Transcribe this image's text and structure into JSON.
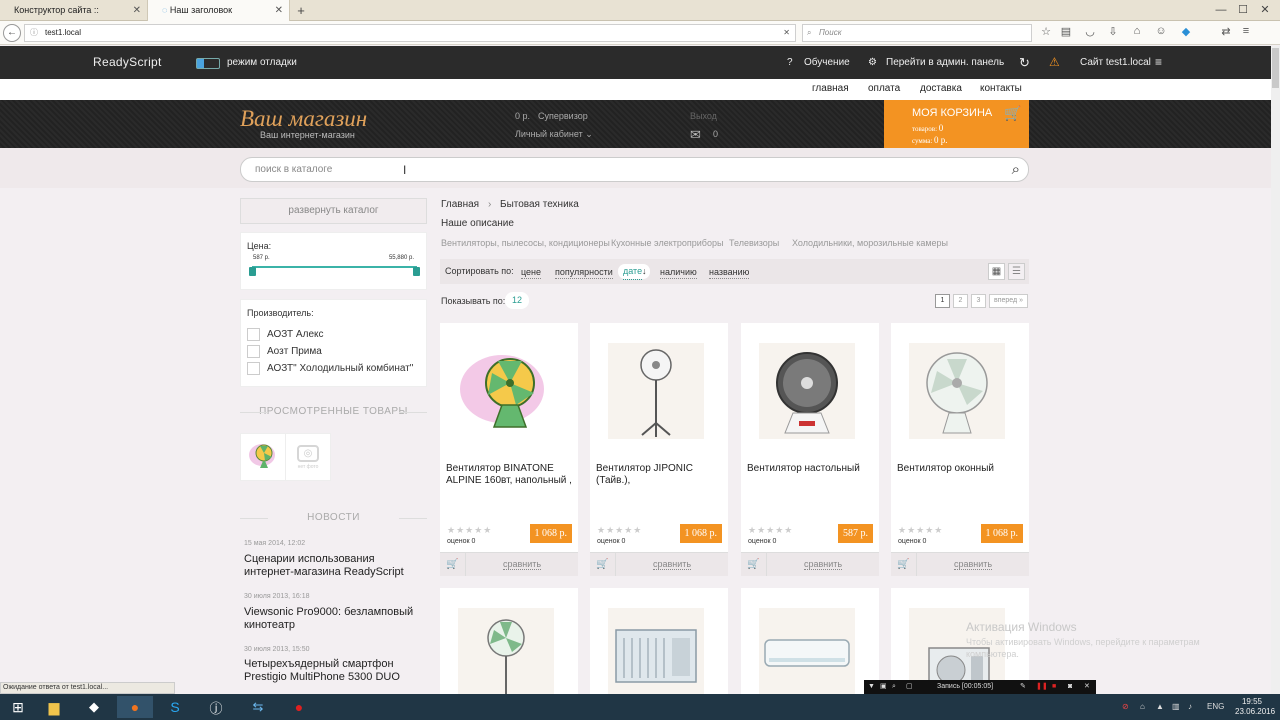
{
  "browser": {
    "tabs": [
      {
        "label": "Конструктор сайта :: Админи..."
      },
      {
        "label": "Наш заголовок"
      }
    ],
    "new_tab": "+",
    "url": "test1.local",
    "search_placeholder": "Поиск",
    "status_text": "Ожидание ответа от test1.local..."
  },
  "admin_bar": {
    "brand": "ReadyScript",
    "debug_label": "режим отладки",
    "tutorial": "Обучение",
    "go_admin": "Перейти в админ. панель",
    "site": "Сайт test1.local"
  },
  "top_menu": [
    "главная",
    "оплата",
    "доставка",
    "контакты"
  ],
  "header": {
    "logo": "Ваш магазин",
    "tagline": "Ваш интернет-магазин",
    "balance": "0 р.",
    "user": "Супервизор",
    "cabinet": "Личный кабинет",
    "logout": "Выход",
    "messages": "0",
    "cart": {
      "title": "МОЯ КОРЗИНА",
      "items_label": "товаров:",
      "items": "0",
      "sum_label": "сумма:",
      "sum": "0 р."
    }
  },
  "search": {
    "placeholder": "поиск в каталоге"
  },
  "sidebar": {
    "expand_catalog": "развернуть каталог",
    "price": {
      "label": "Цена:",
      "min": "587 р.",
      "max": "55,880 р."
    },
    "maker_label": "Производитель:",
    "makers": [
      "АОЗТ Алекс",
      "Аозт Прима",
      "АОЗТ\" Холодильный комбинат\""
    ],
    "viewed_title": "ПРОСМОТРЕННЫЕ ТОВАРЫ",
    "viewed_noimg": "нет фото",
    "news_title": "НОВОСТИ",
    "news": [
      {
        "date": "15 мая 2014, 12:02",
        "title": "Сценарии использования интернет-магазина ReadyScript"
      },
      {
        "date": "30 июля 2013, 16:18",
        "title": "Viewsonic Pro9000: безламповый кинотеатр"
      },
      {
        "date": "30 июля 2013, 15:50",
        "title": "Четырехъядерный смартфон Prestigio MultiPhone 5300 DUO"
      }
    ]
  },
  "main": {
    "breadcrumb": [
      "Главная",
      "Бытовая техника"
    ],
    "description": "Наше описание",
    "subcategories": [
      "Вентиляторы, пылесосы, кондиционеры",
      "Кухонные электроприборы",
      "Телевизоры",
      "Холодильники, морозильные камеры"
    ],
    "sort_label": "Сортировать по:",
    "sort_options": [
      "цене",
      "популярности",
      "дате",
      "наличию",
      "названию"
    ],
    "per_page_label": "Показывать по:",
    "per_page": "12",
    "pages": [
      "1",
      "2",
      "3",
      "вперед »"
    ],
    "products": [
      {
        "title": "Вентилятор BINATONE ALPINE 160вт, напольный ,",
        "price": "1 068 р.",
        "votes": "оценок 0"
      },
      {
        "title": "Вентилятор JIPONIC (Тайв.),",
        "price": "1 068 р.",
        "votes": "оценок 0"
      },
      {
        "title": "Вентилятор настольный",
        "price": "587 р.",
        "votes": "оценок 0"
      },
      {
        "title": "Вентилятор оконный",
        "price": "1 068 р.",
        "votes": "оценок 0"
      }
    ],
    "compare_label": "сравнить",
    "stars": "★★★★★"
  },
  "windows": {
    "activation_title": "Активация Windows",
    "activation_text": "Чтобы активировать Windows, перейдите к параметрам компьютера.",
    "record": "Запись [00:05:05]",
    "lang": "ENG",
    "time": "19:55",
    "date": "23.06.2016"
  }
}
